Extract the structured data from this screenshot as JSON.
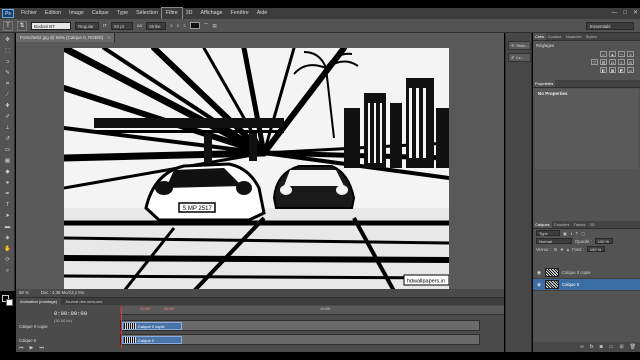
{
  "menubar": {
    "logo": "Ps",
    "items": [
      "Fichier",
      "Edition",
      "Image",
      "Calque",
      "Type",
      "Sélection",
      "Filtre",
      "3D",
      "Affichage",
      "Fenêtre",
      "Aide"
    ],
    "active_item": "Filtre",
    "window_controls": [
      "—",
      "□",
      "✕"
    ]
  },
  "options": {
    "font_family": "Bodoni BT",
    "font_style": "Regular",
    "font_size": "50 pt",
    "antialias": "Strike",
    "workspace": "Essentials"
  },
  "document": {
    "tab_title": "Porsche02.jpg @ 58% (Calque 0, RGB/8)",
    "status_zoom": "58 %",
    "status_doc": "Doc : 4,39 Mo/13,2 Mo",
    "watermark": "hdwallpapers.in",
    "license_plate": "S MP 2517"
  },
  "collapsed": {
    "history_label": "Histo...",
    "brushes_label": "Le..."
  },
  "panels": {
    "top_tabs": [
      "Couleur",
      "Nuancier",
      "Styles",
      "Créa...",
      "Couleu..."
    ],
    "adjustments_title": "Réglages",
    "adjustments_active_tab": "Créa",
    "properties_title": "Propriétés",
    "properties_text": "No Properties",
    "layers_tabs": [
      "Calques",
      "Couches",
      "Tracés",
      "3D"
    ],
    "kind_label": "Type",
    "blend_mode": "Normal",
    "opacity_label": "Opacité :",
    "opacity_value": "100 %",
    "lock_label": "Verrou :",
    "fill_label": "Fond :",
    "fill_value": "100 %",
    "layers": [
      {
        "name": "Calque 0 copie",
        "selected": false
      },
      {
        "name": "Calque 0",
        "selected": true
      }
    ]
  },
  "timeline": {
    "tabs": [
      "Animation (montage)",
      "Journal des mesures"
    ],
    "timecode": "0:00:00:00",
    "fps": "(30,00 i/s)",
    "ruler_marks": [
      "01:00f",
      "05:00f",
      "10:00f"
    ],
    "tracks": [
      {
        "name": "Calque 0 copie",
        "clip": "Calque 0 copie"
      },
      {
        "name": "Calque 0",
        "clip": "Calque 0"
      }
    ]
  },
  "colors": {
    "ui_bg": "#535353",
    "ui_dark": "#3c3c3c",
    "selection": "#3a6ea5",
    "accent_red": "#d33333"
  }
}
